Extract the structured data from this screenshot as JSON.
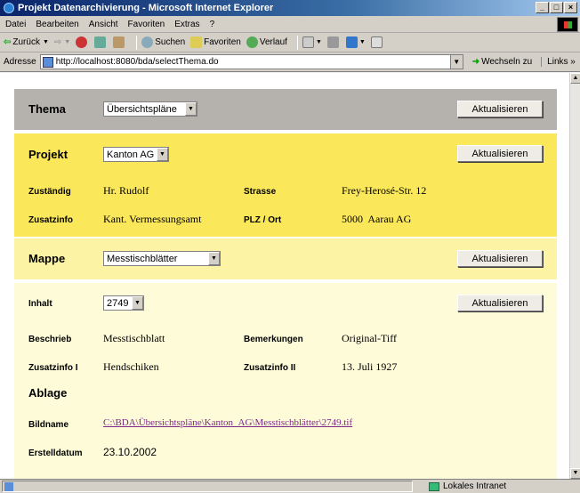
{
  "window": {
    "title": "Projekt Datenarchivierung - Microsoft Internet Explorer"
  },
  "menu": [
    "Datei",
    "Bearbeiten",
    "Ansicht",
    "Favoriten",
    "Extras",
    "?"
  ],
  "toolbar": {
    "back": "Zurück",
    "search": "Suchen",
    "favorites": "Favoriten",
    "history": "Verlauf"
  },
  "address": {
    "label": "Adresse",
    "url": "http://localhost:8080/bda/selectThema.do",
    "go": "Wechseln zu",
    "links": "Links"
  },
  "thema": {
    "label": "Thema",
    "selected": "Übersichtspläne",
    "button": "Aktualisieren"
  },
  "projekt": {
    "label": "Projekt",
    "selected": "Kanton AG",
    "button": "Aktualisieren",
    "zustaendig_label": "Zuständig",
    "zustaendig": "Hr. Rudolf",
    "strasse_label": "Strasse",
    "strasse": "Frey-Herosé-Str. 12",
    "zusatzinfo_label": "Zusatzinfo",
    "zusatzinfo": "Kant. Vermessungsamt",
    "plz_label": "PLZ / Ort",
    "plz": "5000  Aarau AG"
  },
  "mappe": {
    "label": "Mappe",
    "selected": "Messtischblätter",
    "button": "Aktualisieren"
  },
  "inhalt": {
    "label": "Inhalt",
    "selected": "2749",
    "button": "Aktualisieren",
    "beschrieb_label": "Beschrieb",
    "beschrieb": "Messtischblatt",
    "bemerkungen_label": "Bemerkungen",
    "bemerkungen": "Original-Tiff",
    "zusatz1_label": "Zusatzinfo I",
    "zusatz1": "Hendschiken",
    "zusatz2_label": "Zusatzinfo II",
    "zusatz2": "13. Juli 1927",
    "ablage_label": "Ablage",
    "bildname_label": "Bildname",
    "bildname": "C:\\BDA\\Übersichtspläne\\Kanton_AG\\Messtischblätter\\2749.tif",
    "erstelldatum_label": "Erstelldatum",
    "erstelldatum": "23.10.2002"
  },
  "status": {
    "zone": "Lokales Intranet"
  }
}
